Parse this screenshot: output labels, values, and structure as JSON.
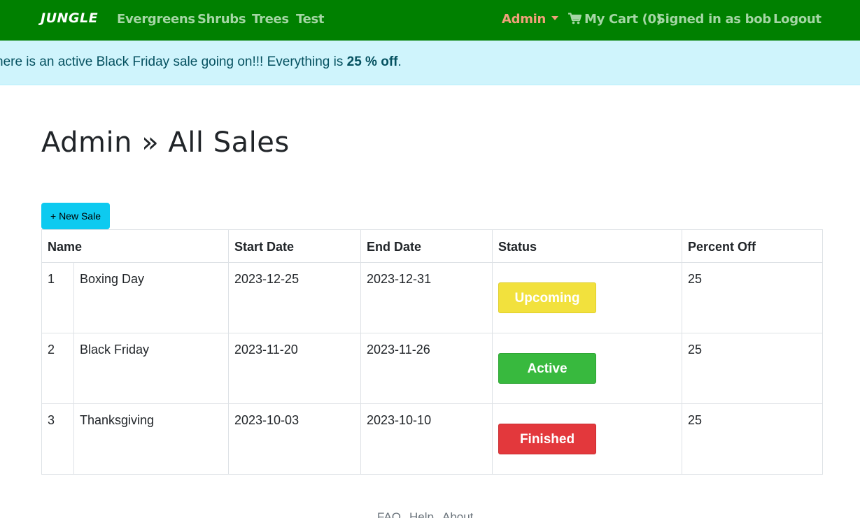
{
  "navbar": {
    "brand": "JUNGLE",
    "links": [
      "Evergreens",
      "Shrubs",
      "Trees",
      "Test"
    ],
    "admin_label": "Admin",
    "cart_label": "My Cart (0)",
    "signed_in": "Signed in as bob",
    "logout": "Logout"
  },
  "alert": {
    "prefix": "here is an active Black Friday sale going on!!! Everything is ",
    "highlight": "25 % off",
    "suffix": "."
  },
  "page": {
    "title": "Admin » All Sales",
    "new_sale_button": "+ New Sale"
  },
  "table": {
    "headers": [
      "Name",
      "Start Date",
      "End Date",
      "Status",
      "Percent Off"
    ],
    "rows": [
      {
        "id": "1",
        "name": "Boxing Day",
        "start": "2023-12-25",
        "end": "2023-12-31",
        "status": "Upcoming",
        "percent": "25"
      },
      {
        "id": "2",
        "name": "Black Friday",
        "start": "2023-11-20",
        "end": "2023-11-26",
        "status": "Active",
        "percent": "25"
      },
      {
        "id": "3",
        "name": "Thanksgiving",
        "start": "2023-10-03",
        "end": "2023-10-10",
        "status": "Finished",
        "percent": "25"
      }
    ]
  },
  "status_colors": {
    "upcoming": "#f2e13d",
    "active": "#38b93e",
    "finished": "#e3383c"
  },
  "theme": {
    "navbar_bg": "#008000",
    "alert_bg": "#cff4fc",
    "button_bg": "#0dcaf0"
  },
  "footer": {
    "links": [
      "FAQ",
      "Help",
      "About"
    ]
  }
}
